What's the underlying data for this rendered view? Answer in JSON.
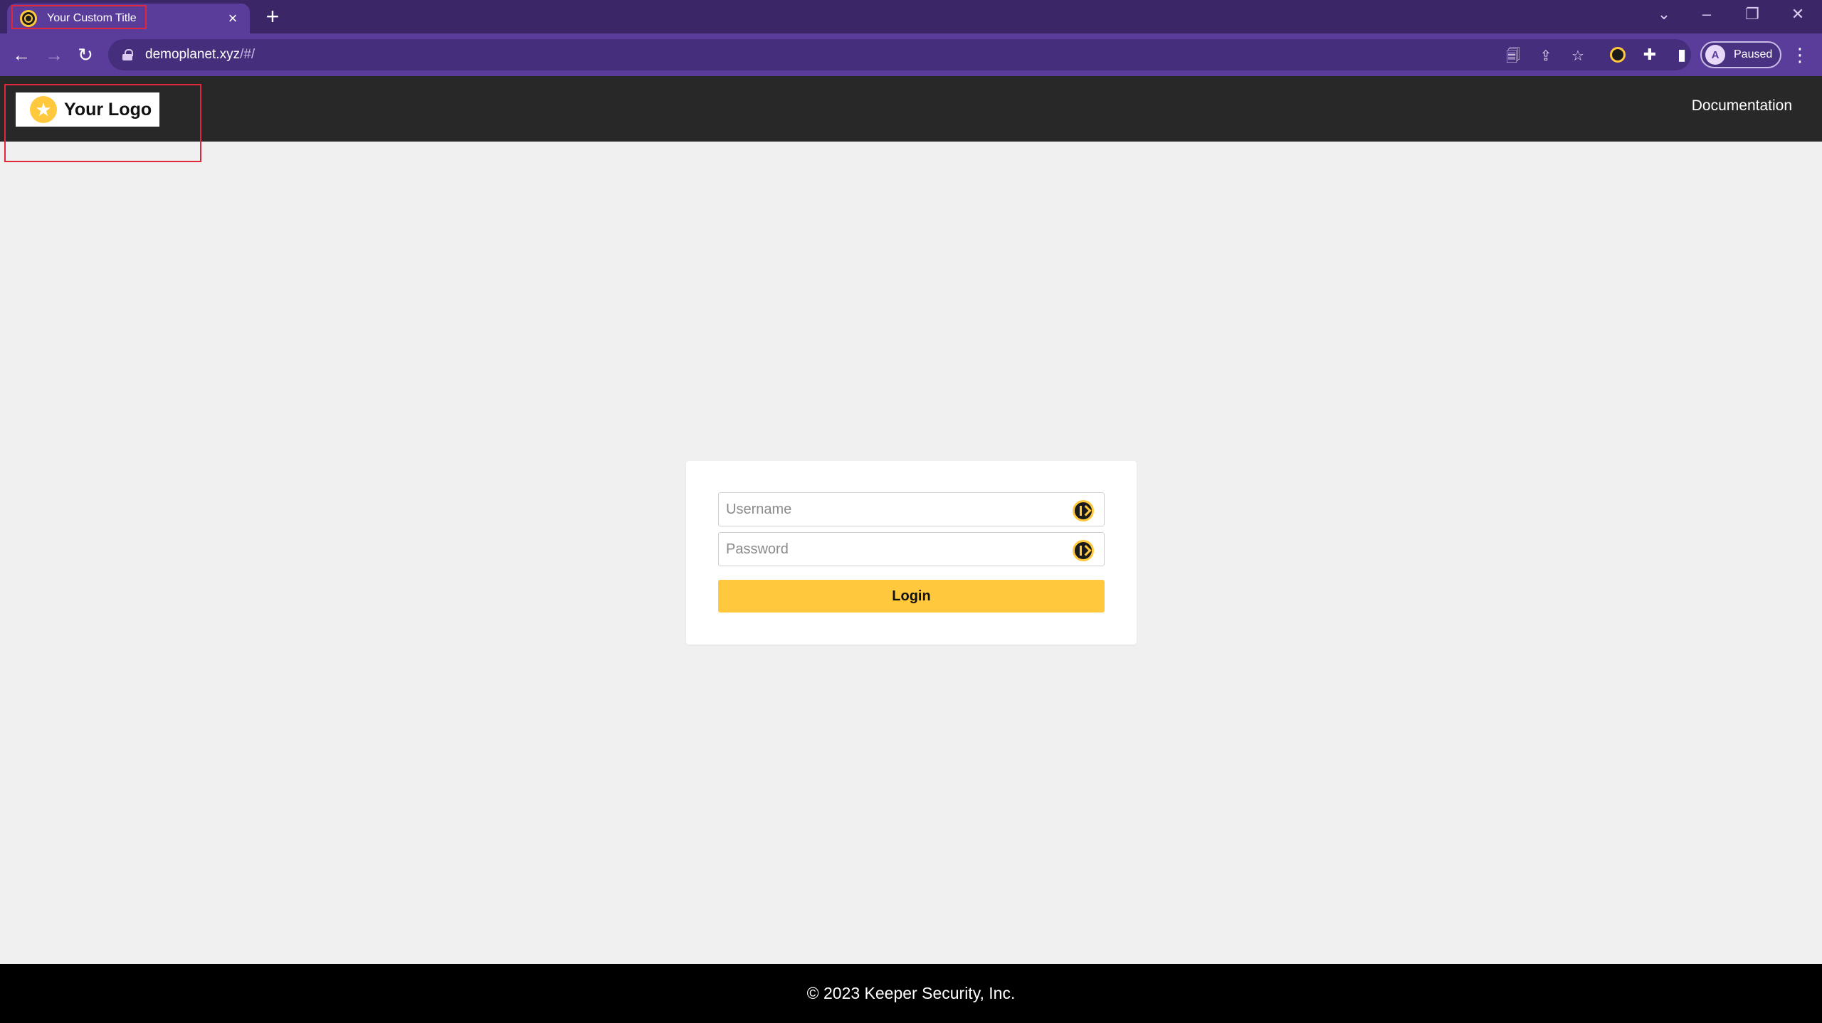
{
  "browser": {
    "tab": {
      "title": "Your Custom Title",
      "close_symbol": "×"
    },
    "new_tab_symbol": "+",
    "window_controls": {
      "tab_search": "⌄",
      "minimize": "–",
      "restore": "❐",
      "close": "✕"
    },
    "nav": {
      "back": "←",
      "forward": "→",
      "reload": "↻"
    },
    "address": {
      "host": "demoplanet.xyz",
      "path": "/#/"
    },
    "toolbar_icons": {
      "save_page": "🗐",
      "share": "⇪",
      "bookmark": "☆",
      "extensions": "✚",
      "side_panel": "▮",
      "menu": "⋮"
    },
    "profile": {
      "status": "Paused",
      "avatar_initial": "A"
    }
  },
  "header": {
    "logo_text": "Your Logo",
    "logo_star": "★",
    "nav_link": "Documentation"
  },
  "login_form": {
    "username_placeholder": "Username",
    "password_placeholder": "Password",
    "login_label": "Login"
  },
  "footer": {
    "copyright": "© 2023 Keeper Security, Inc."
  },
  "colors": {
    "browser_frame": "#3b2667",
    "browser_toolbar": "#5a3d9a",
    "header_bg": "#282828",
    "accent_yellow": "#ffc83d",
    "page_bg": "#f0f0f0",
    "footer_bg": "#000000",
    "annotation_red": "#e0283a"
  }
}
